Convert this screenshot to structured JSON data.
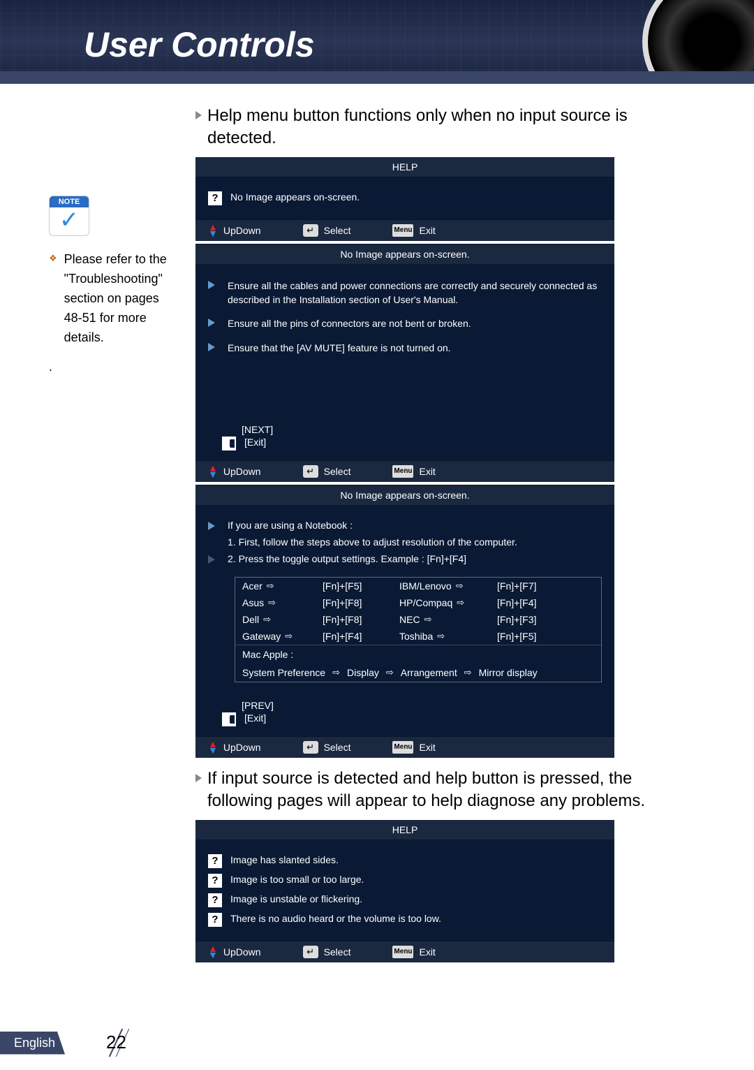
{
  "header": {
    "title": "User Controls"
  },
  "intro1": "Help menu button functions only when no input source is detected.",
  "intro2": "If input source is detected and help button is pressed, the following pages will appear to help diagnose any problems.",
  "sidebar": {
    "note_label": "NOTE",
    "tip": "Please refer to the \"Troubleshooting\" section on pages 48-51 for more details."
  },
  "panel1": {
    "title": "HELP",
    "item": "No Image appears on-screen."
  },
  "nav": {
    "updown": "UpDown",
    "select": "Select",
    "exit": "Exit",
    "menu": "Menu"
  },
  "panel2": {
    "title": "No Image appears on-screen.",
    "tips": [
      "Ensure all the cables and power connections are correctly and securely connected as described in the Installation section of User's Manual.",
      "Ensure all the pins of connectors are not bent or broken.",
      "Ensure that the [AV MUTE] feature is not turned on."
    ],
    "next": "[NEXT]",
    "exit": "[Exit]"
  },
  "panel3": {
    "title": "No Image appears on-screen.",
    "line1": "If you are using a Notebook :",
    "sub1": "1. First, follow the steps above to adjust resolution of the computer.",
    "line2": "2. Press the toggle output settings. Example : [Fn]+[F4]",
    "fn_left": [
      {
        "brand": "Acer",
        "key": "[Fn]+[F5]"
      },
      {
        "brand": "Asus",
        "key": "[Fn]+[F8]"
      },
      {
        "brand": "Dell",
        "key": "[Fn]+[F8]"
      },
      {
        "brand": "Gateway",
        "key": "[Fn]+[F4]"
      }
    ],
    "fn_right": [
      {
        "brand": "IBM/Lenovo",
        "key": "[Fn]+[F7]"
      },
      {
        "brand": "HP/Compaq",
        "key": "[Fn]+[F4]"
      },
      {
        "brand": "NEC",
        "key": "[Fn]+[F3]"
      },
      {
        "brand": "Toshiba",
        "key": "[Fn]+[F5]"
      }
    ],
    "mac": "Mac Apple :",
    "mac_path": [
      "System Preference",
      "Display",
      "Arrangement",
      "Mirror display"
    ],
    "prev": "[PREV]",
    "exit": "[Exit]"
  },
  "panel4": {
    "title": "HELP",
    "items": [
      "Image has slanted sides.",
      "Image is too small or too large.",
      "Image is unstable or flickering.",
      "There is no audio heard or the volume is too low."
    ]
  },
  "footer": {
    "lang": "English",
    "page": "22"
  }
}
